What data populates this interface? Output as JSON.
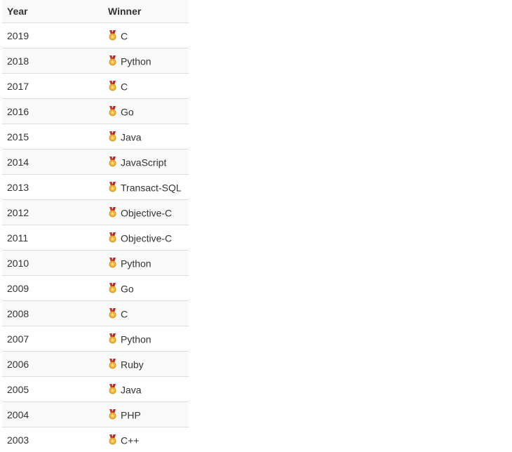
{
  "table": {
    "headers": {
      "year": "Year",
      "winner": "Winner"
    },
    "medal_icon": "medal-icon",
    "colors": {
      "row_stripe": "#f9f9f9",
      "border": "#dddddd",
      "text": "#333333",
      "medal_ribbon": "#d9302c",
      "medal_gold": "#f2b632"
    },
    "rows": [
      {
        "year": "2019",
        "winner": "C"
      },
      {
        "year": "2018",
        "winner": "Python"
      },
      {
        "year": "2017",
        "winner": "C"
      },
      {
        "year": "2016",
        "winner": "Go"
      },
      {
        "year": "2015",
        "winner": "Java"
      },
      {
        "year": "2014",
        "winner": "JavaScript"
      },
      {
        "year": "2013",
        "winner": "Transact-SQL"
      },
      {
        "year": "2012",
        "winner": "Objective-C"
      },
      {
        "year": "2011",
        "winner": "Objective-C"
      },
      {
        "year": "2010",
        "winner": "Python"
      },
      {
        "year": "2009",
        "winner": "Go"
      },
      {
        "year": "2008",
        "winner": "C"
      },
      {
        "year": "2007",
        "winner": "Python"
      },
      {
        "year": "2006",
        "winner": "Ruby"
      },
      {
        "year": "2005",
        "winner": "Java"
      },
      {
        "year": "2004",
        "winner": "PHP"
      },
      {
        "year": "2003",
        "winner": "C++"
      }
    ]
  }
}
